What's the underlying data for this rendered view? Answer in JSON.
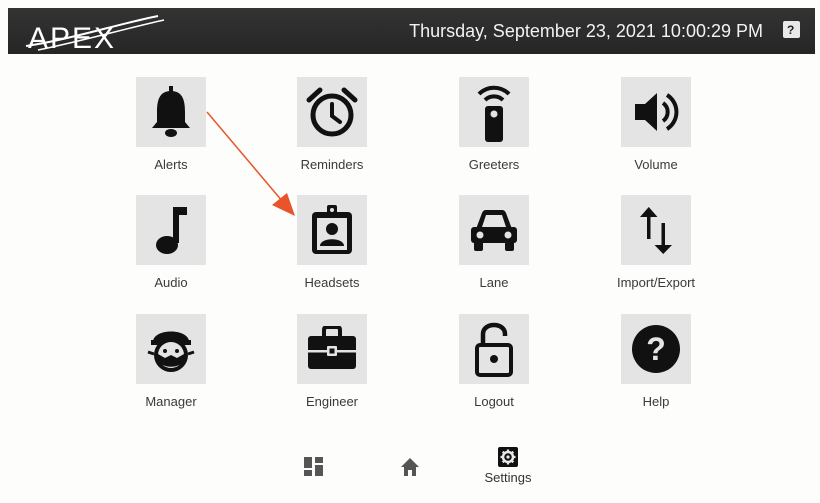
{
  "header": {
    "logo_text": "APEX",
    "datetime": "Thursday, September 23, 2021 10:00:29 PM",
    "help_icon": "help-square-icon"
  },
  "tiles": [
    {
      "label": "Alerts",
      "icon": "bell-icon"
    },
    {
      "label": "Reminders",
      "icon": "alarm-clock-icon"
    },
    {
      "label": "Greeters",
      "icon": "greeter-remote-icon"
    },
    {
      "label": "Volume",
      "icon": "speaker-icon"
    },
    {
      "label": "Audio",
      "icon": "music-note-icon"
    },
    {
      "label": "Headsets",
      "icon": "id-badge-icon"
    },
    {
      "label": "Lane",
      "icon": "car-icon"
    },
    {
      "label": "Import/Export",
      "icon": "up-down-arrows-icon"
    },
    {
      "label": "Manager",
      "icon": "manager-face-icon"
    },
    {
      "label": "Engineer",
      "icon": "briefcase-icon"
    },
    {
      "label": "Logout",
      "icon": "padlock-icon"
    },
    {
      "label": "Help",
      "icon": "question-circle-icon"
    }
  ],
  "bottom_nav": [
    {
      "label": "",
      "icon": "dashboard-grid-icon"
    },
    {
      "label": "",
      "icon": "home-icon"
    },
    {
      "label": "Settings",
      "icon": "settings-gear-icon"
    }
  ],
  "colors": {
    "header_bg": "#2b2b2b",
    "tile_bg": "#e4e4e4",
    "icon_fill": "#111111",
    "annotation_arrow": "#e8552a"
  }
}
